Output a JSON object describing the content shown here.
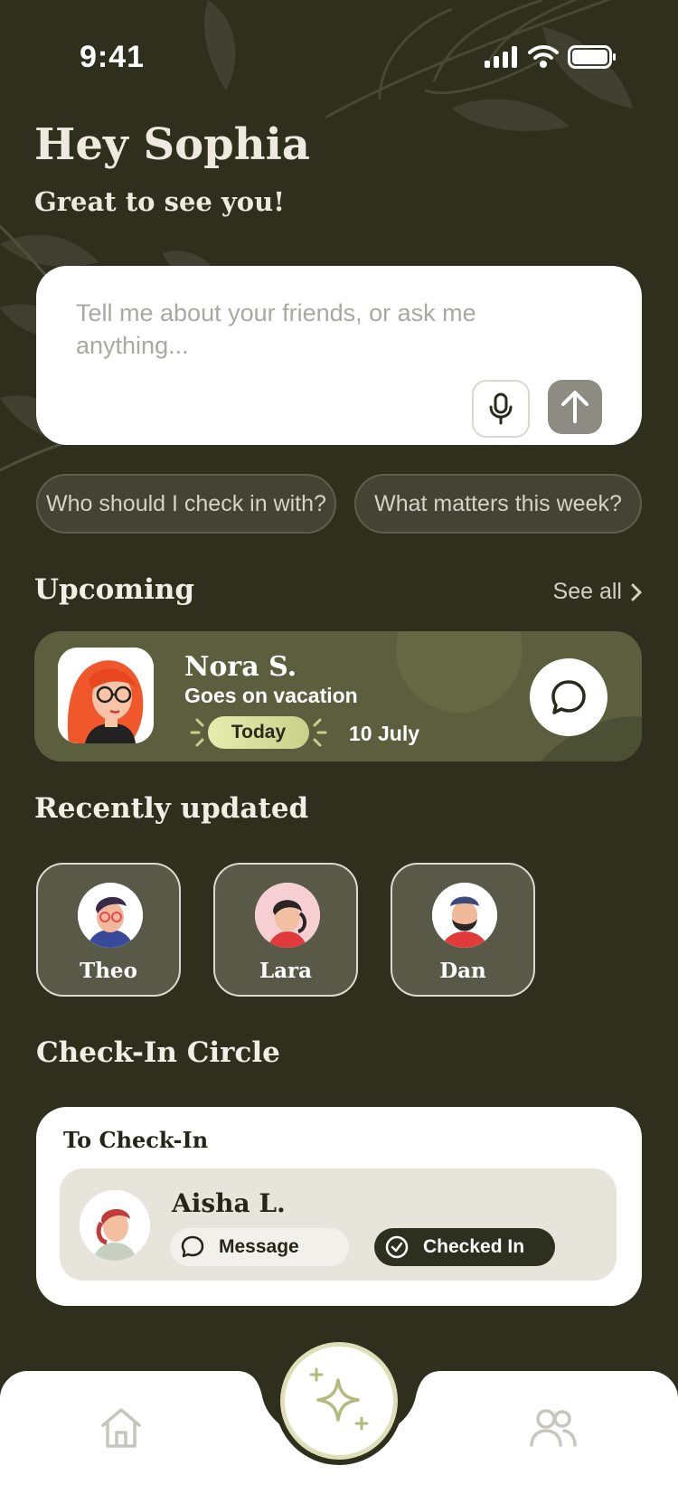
{
  "status_bar": {
    "time": "9:41"
  },
  "greeting": {
    "title": "Hey Sophia",
    "subtitle": "Great to see you!"
  },
  "ask": {
    "placeholder": "Tell me about your friends, or ask me anything..."
  },
  "suggestions": [
    {
      "label": "Who should I check in with?"
    },
    {
      "label": "What matters this week?"
    }
  ],
  "upcoming": {
    "title": "Upcoming",
    "see_all": "See all",
    "item": {
      "name": "Nora S.",
      "description": "Goes on vacation",
      "badge": "Today",
      "date": "10 July"
    }
  },
  "recent": {
    "title": "Recently updated",
    "people": [
      {
        "name": "Theo"
      },
      {
        "name": "Lara"
      },
      {
        "name": "Dan"
      }
    ]
  },
  "checkin": {
    "title": "Check-In Circle",
    "card_label": "To Check-In",
    "person": {
      "name": "Aisha L.",
      "message_label": "Message",
      "checked_label": "Checked In"
    }
  },
  "colors": {
    "background": "#2f2f1e",
    "card": "#5b5f3e",
    "accent": "#c9d089"
  },
  "icons": [
    "signal-icon",
    "wifi-icon",
    "battery-icon",
    "mic-icon",
    "arrow-up-icon",
    "chevron-right-icon",
    "chat-bubble-icon",
    "check-circle-icon",
    "home-icon",
    "sparkle-icon",
    "people-icon"
  ]
}
